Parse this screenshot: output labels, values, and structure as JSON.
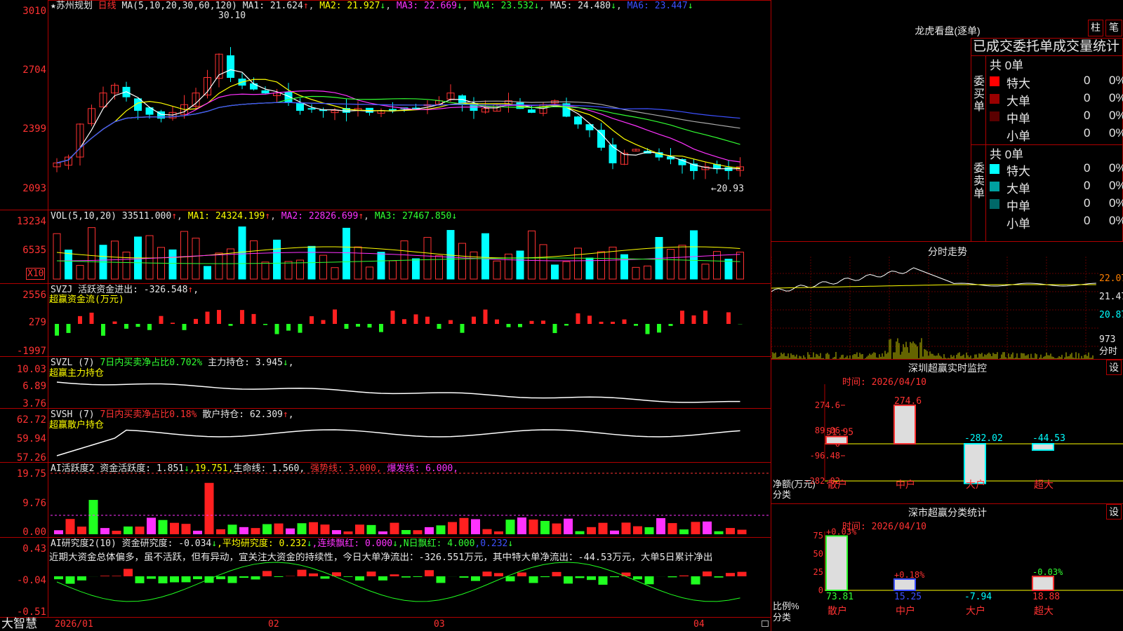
{
  "stock": {
    "star": "★",
    "name": "苏州规划",
    "period": "日线"
  },
  "main": {
    "ma_label": "MA(5,10,20,30,60,120)",
    "ma1": "MA1: 21.624",
    "ma1_arrow": "↑",
    "ma2": "MA2: 21.927",
    "ma2_arrow": "↓",
    "ma3": "MA3: 22.669",
    "ma3_arrow": "↓",
    "ma4": "MA4: 23.532",
    "ma4_arrow": "↓",
    "ma5": "MA5: 24.480",
    "ma5_arrow": "↓",
    "ma6": "MA6: 23.447",
    "ma6_arrow": "↓",
    "y_ticks": [
      "3010",
      "2704",
      "2399",
      "2093"
    ],
    "high_label": "30.10",
    "low_label": "←20.93"
  },
  "vol": {
    "label": "VOL(5,10,20)",
    "value": "33511.000",
    "value_arrow": "↑",
    "ma1": "MA1: 24324.199",
    "ma1_arrow": "↑",
    "ma2": "MA2: 22826.699",
    "ma2_arrow": "↑",
    "ma3": "MA3: 27467.850",
    "ma3_arrow": "↓",
    "y_ticks": [
      "13234",
      "6535"
    ],
    "unit": "X10"
  },
  "svzj": {
    "label": "SVZJ  活跃资金进出: -326.548",
    "arrow": "↑",
    "sub": "超赢资金流(万元)",
    "y_ticks": [
      "2556",
      "279",
      "-1997"
    ]
  },
  "svzl": {
    "label": "SVZL (7)",
    "stat": "7日内买卖净占比0.702%",
    "hold": "主力持仓: 3.945",
    "arrow": "↓",
    "comma": ",",
    "sub": "超赢主力持仓",
    "y_ticks": [
      "10.03",
      "6.89",
      "3.76"
    ]
  },
  "svsh": {
    "label": "SVSH (7)",
    "stat": "7日内买卖净占比0.18%",
    "hold": "散户持仓: 62.309",
    "arrow": "↑",
    "comma": ",",
    "sub": "超赢散户持仓",
    "y_ticks": [
      "62.72",
      "59.94",
      "57.26"
    ]
  },
  "ai1": {
    "label": "AI活跃度2 资金活跃度: 1.851",
    "arrow": "↓",
    "v2": ",19.751,",
    "life": "生命线: 1.560,",
    "strong": "强势线: 3.000,",
    "burst": "爆发线: 6.000,",
    "y_ticks": [
      "19.75",
      "9.76",
      "0.00"
    ]
  },
  "ai2": {
    "label": "AI研究度2(10) 资金研究度: -0.034",
    "a1": "↓",
    "avg": ",平均研究度: 0.232",
    "a2": "↓",
    "lx": ",连续飘红: 0.000",
    "a3": "↓",
    "nd": ",N日飘红: 4.000",
    "nv": ",0.232",
    "a4": "↓",
    "comment": "近期大资金总体偏多，虽不活跃，但有异动，宜关注大资金的持续性，今日大单净流出：-326.551万元，其中特大单净流出：-44.53万元，大单5日累计净出",
    "y_ticks": [
      "0.43",
      "-0.04",
      "-0.51"
    ]
  },
  "xaxis": [
    "2026/01",
    "02",
    "03",
    "04"
  ],
  "logo": "大智慧",
  "right": {
    "lhb_title": "龙虎看盘(逐单)",
    "btn_zhu": "柱",
    "btn_bi": "笔",
    "table_title": "已成交委托单成交量统计",
    "buy_label": "委买单",
    "sell_label": "委卖单",
    "buy_total": "共 0单",
    "sell_total": "共 0单",
    "rows": [
      {
        "name": "特大",
        "count": "0",
        "pct": "0%",
        "color": "#ff0000"
      },
      {
        "name": "大单",
        "count": "0",
        "pct": "0%",
        "color": "#9a0000"
      },
      {
        "name": "中单",
        "count": "0",
        "pct": "0%",
        "color": "#5a0000"
      },
      {
        "name": "小单",
        "count": "0",
        "pct": "0%",
        "color": ""
      }
    ],
    "sell_rows": [
      {
        "name": "特大",
        "count": "0",
        "pct": "0%",
        "color": "#00ffff"
      },
      {
        "name": "大单",
        "count": "0",
        "pct": "0%",
        "color": "#00a0a0"
      },
      {
        "name": "中单",
        "count": "0",
        "pct": "0%",
        "color": "#006868"
      },
      {
        "name": "小单",
        "count": "0",
        "pct": "0%",
        "color": ""
      }
    ],
    "fs_title": "分时走势",
    "fs_ticks": [
      "22.07",
      "21.47",
      "20.87"
    ],
    "fs_vol": "973",
    "fs_unit": "分时",
    "sz_title": "深圳超赢实时监控",
    "sz_btn": "设",
    "sz_time": "时间: 2026/04/10",
    "sz_ticks": [
      "274.6",
      "89.06",
      "0",
      "-96.48",
      "-282.02"
    ],
    "sz_bars": [
      {
        "cat": "散户",
        "val": "51.95"
      },
      {
        "cat": "中户",
        "val": "274.6"
      },
      {
        "cat": "大户",
        "val": "-282.02"
      },
      {
        "cat": "超大",
        "val": "-44.53"
      }
    ],
    "sz_ylabel": "净额(万元)",
    "sz_xlabel": "分类",
    "ss_title": "深市超赢分类统计",
    "ss_btn": "设",
    "ss_time": "时间: 2026/04/10",
    "ss_ticks": [
      "75",
      "50",
      "25",
      "0"
    ],
    "ss_bars": [
      {
        "cat": "散户",
        "val": "73.81",
        "top": "+0.03%"
      },
      {
        "cat": "中户",
        "val": "15.25",
        "top": "+0.18%"
      },
      {
        "cat": "大户",
        "val": "-7.94",
        "top": ""
      },
      {
        "cat": "超大",
        "val": "18.88",
        "top": "-0.03%"
      }
    ],
    "ss_ylabel": "比例%",
    "ss_xlabel": "分类"
  }
}
